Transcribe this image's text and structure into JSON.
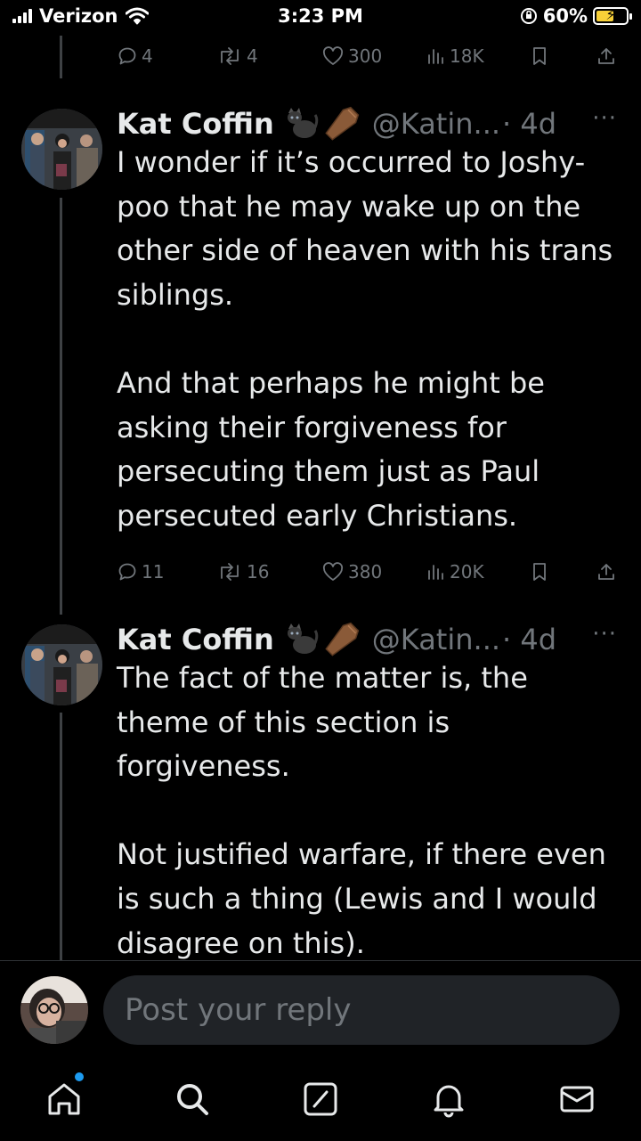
{
  "status_bar": {
    "carrier": "Verizon",
    "time": "3:23 PM",
    "battery": "60%",
    "battery_level": 0.6
  },
  "top_actions": {
    "replies": "4",
    "reposts": "4",
    "likes": "300",
    "views": "18K"
  },
  "tweets": [
    {
      "name": "Kat Coffin",
      "emoji": [
        "black-cat-icon",
        "coffin-icon"
      ],
      "handle": "@Katin...",
      "time": "· 4d",
      "more": "···",
      "paragraphs": [
        "I wonder if it’s occurred to Joshy-poo that he may wake up on the other side of heaven with his trans siblings.",
        "And that perhaps he might be asking their forgiveness for persecuting them just as Paul persecuted early Christians."
      ],
      "actions": {
        "replies": "11",
        "reposts": "16",
        "likes": "380",
        "views": "20K"
      }
    },
    {
      "name": "Kat Coffin",
      "emoji": [
        "black-cat-icon",
        "coffin-icon"
      ],
      "handle": "@Katin...",
      "time": "· 4d",
      "more": "···",
      "paragraphs": [
        "The fact of the matter is, the theme of this section is forgiveness.",
        "Not justified warfare, if there even is such a thing (Lewis and I would disagree on this)."
      ]
    }
  ],
  "reply_bar": {
    "placeholder": "Post your reply"
  },
  "nav": [
    "home-icon",
    "search-icon",
    "compose-icon",
    "notifications-icon",
    "messages-icon"
  ],
  "colors": {
    "background": "#000000",
    "text": "#e7e9ea",
    "muted": "#71767b",
    "accent": "#1d9bf0",
    "battery": "#f7d038"
  }
}
